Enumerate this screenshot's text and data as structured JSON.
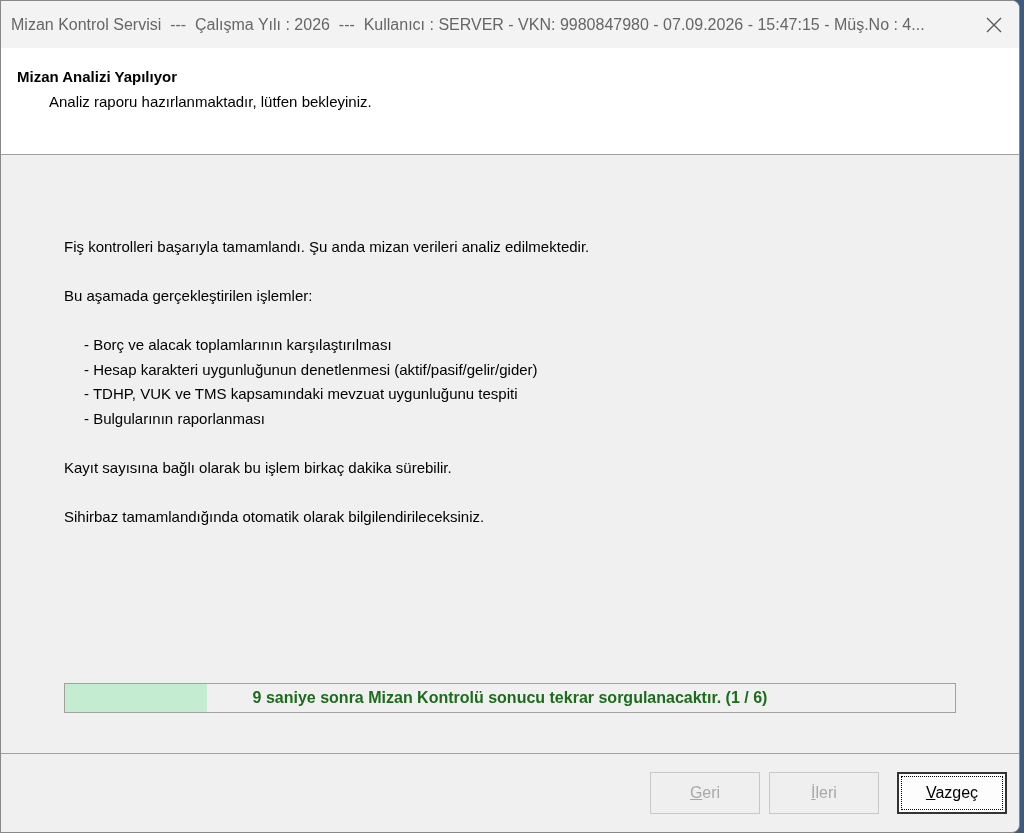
{
  "window": {
    "title": "Mizan Kontrol Servisi  ---  Çalışma Yılı : 2026  ---  Kullanıcı : SERVER - VKN: 9980847980 - 07.09.2026 - 15:47:15 - Müş.No : 4..."
  },
  "header": {
    "title": "Mizan Analizi Yapılıyor",
    "subtitle": "Analiz raporu hazırlanmaktadır, lütfen bekleyiniz."
  },
  "body": {
    "intro": "Fiş kontrolleri başarıyla tamamlandı. Şu anda mizan verileri analiz edilmektedir.",
    "list_title": "Bu aşamada gerçekleştirilen işlemler:",
    "steps": [
      "- Borç ve alacak toplamlarının karşılaştırılması",
      "- Hesap karakteri uygunluğunun denetlenmesi (aktif/pasif/gelir/gider)",
      "- TDHP, VUK ve TMS kapsamındaki mevzuat uygunluğunu tespiti",
      "- Bulgularının raporlanması"
    ],
    "notes": [
      "Kayıt sayısına bağlı olarak bu işlem birkaç dakika sürebilir.",
      "Sihirbaz tamamlandığında otomatik olarak bilgilendirileceksiniz."
    ]
  },
  "progress": {
    "level": 0.16,
    "text": "9 saniye sonra Mizan Kontrolü sonucu tekrar sorgulanacaktır. (1 / 6)"
  },
  "buttons": [
    {
      "label": "Geri",
      "disabled": true,
      "selected": false
    },
    {
      "label": "İleri",
      "disabled": true,
      "selected": false
    },
    {
      "label": "Vazgeç",
      "disabled": false,
      "selected": true
    }
  ]
}
